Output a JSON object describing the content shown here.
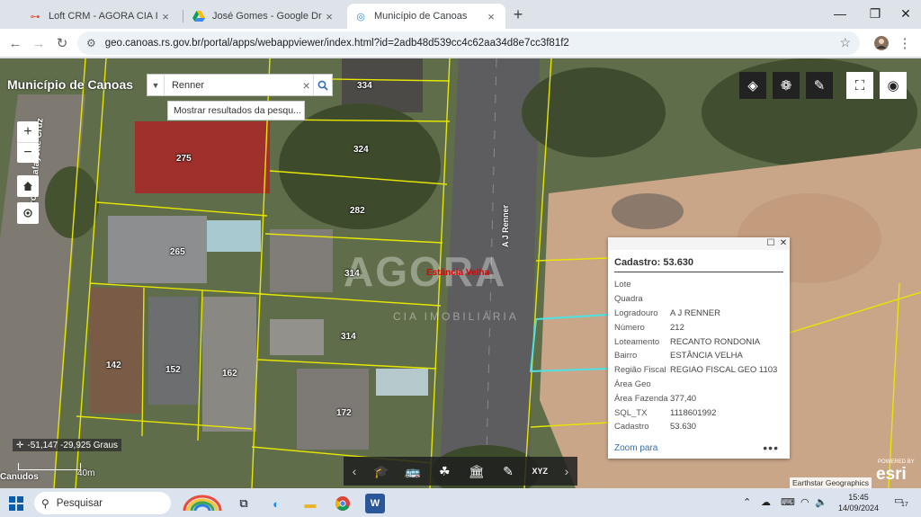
{
  "browser": {
    "tabs": [
      {
        "title": "Loft CRM - AGORA CIA IMOBILI",
        "icon": "crm-icon",
        "active": false
      },
      {
        "title": "José Gomes - Google Drive",
        "icon": "google-drive-icon",
        "active": false
      },
      {
        "title": "Município de Canoas",
        "icon": "arcgis-icon",
        "active": true
      }
    ],
    "url": "geo.canoas.rs.gov.br/portal/apps/webappviewer/index.html?id=2adb48d539cc4c62aa34d8e7cc3f81f2"
  },
  "app": {
    "title": "Município de Canoas",
    "search": {
      "value": "Renner",
      "suggestion": "Mostrar resultados da pesqu..."
    }
  },
  "map": {
    "lots": [
      "334",
      "275",
      "324",
      "282",
      "265",
      "314",
      "314",
      "142",
      "152",
      "162",
      "172"
    ],
    "streets": {
      "left": "Coronel Lafayette Cruz",
      "main": "A J Renner",
      "red": "Estância Velha",
      "bottom": "Canudos"
    },
    "watermark": {
      "name": "AGORA",
      "sub": "CIA IMOBILIÁRIA"
    },
    "coords": "-51,147 -29,925 Graus",
    "scale": "40m",
    "attribution": "Earthstar Geographics",
    "esri_small": "POWERED BY",
    "esri": "esri"
  },
  "popup": {
    "title": "Cadastro: 53.630",
    "rows": [
      {
        "k": "Lote",
        "v": ""
      },
      {
        "k": "Quadra",
        "v": ""
      },
      {
        "k": "Logradouro",
        "v": "A J RENNER"
      },
      {
        "k": "Número",
        "v": "212"
      },
      {
        "k": "Loteamento",
        "v": "RECANTO RONDONIA"
      },
      {
        "k": "Bairro",
        "v": "ESTÂNCIA VELHA"
      },
      {
        "k": "Região Fiscal",
        "v": "REGIAO FISCAL GEO 1103"
      },
      {
        "k": "Área Geo",
        "v": ""
      },
      {
        "k": "Área Fazenda",
        "v": "377,40"
      },
      {
        "k": "SQL_TX",
        "v": "1118601992"
      },
      {
        "k": "Cadastro",
        "v": "53.630"
      }
    ],
    "zoom_link": "Zoom para",
    "more": "•••"
  },
  "taskbar": {
    "search_label": "Pesquisar",
    "time": "15:45",
    "date": "14/09/2024",
    "notif_count": "17"
  },
  "colors": {
    "lot_lines": "#e6e600",
    "selection": "#4ee1e1",
    "link": "#2f6fb4"
  }
}
